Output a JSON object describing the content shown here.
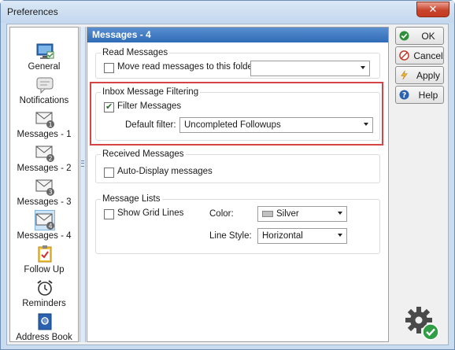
{
  "window": {
    "title": "Preferences",
    "close_glyph": "✕"
  },
  "nav": {
    "items": [
      {
        "label": "General",
        "icon": "monitor-icon"
      },
      {
        "label": "Notifications",
        "icon": "speech-bubble-icon"
      },
      {
        "label": "Messages - 1",
        "icon": "envelope-1-icon"
      },
      {
        "label": "Messages - 2",
        "icon": "envelope-2-icon"
      },
      {
        "label": "Messages - 3",
        "icon": "envelope-3-icon"
      },
      {
        "label": "Messages - 4",
        "icon": "envelope-4-icon",
        "selected": true
      },
      {
        "label": "Follow Up",
        "icon": "clipboard-check-icon"
      },
      {
        "label": "Reminders",
        "icon": "alarm-clock-icon"
      },
      {
        "label": "Address Book",
        "icon": "address-book-icon"
      }
    ]
  },
  "panel": {
    "title": "Messages - 4",
    "read_messages": {
      "title": "Read Messages",
      "move_label": "Move read messages to this folder:",
      "move_checked": false,
      "folder_value": ""
    },
    "inbox_filtering": {
      "title": "Inbox Message Filtering",
      "filter_label": "Filter Messages",
      "filter_checked": true,
      "default_filter_label": "Default filter:",
      "default_filter_value": "Uncompleted Followups"
    },
    "received_messages": {
      "title": "Received Messages",
      "auto_display_label": "Auto-Display messages",
      "auto_display_checked": false
    },
    "message_lists": {
      "title": "Message Lists",
      "grid_lines_label": "Show Grid Lines",
      "grid_lines_checked": false,
      "color_label": "Color:",
      "color_value": "Silver",
      "line_style_label": "Line Style:",
      "line_style_value": "Horizontal"
    }
  },
  "buttons": {
    "ok": "OK",
    "cancel": "Cancel",
    "apply": "Apply",
    "help": "Help"
  },
  "colors": {
    "header_blue": "#3b78c4",
    "highlight_red": "#d64545",
    "ok_green": "#2f8f3a",
    "cancel_red": "#c0392b",
    "help_blue": "#2a62b0"
  }
}
